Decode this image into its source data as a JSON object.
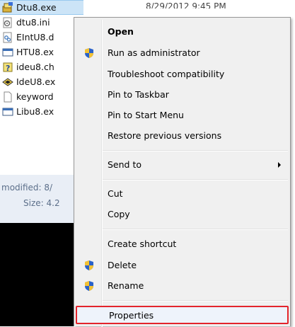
{
  "files": [
    {
      "name": "Dtu8.exe",
      "icon": "app-setup-icon",
      "selected": true
    },
    {
      "name": "dtu8.ini",
      "icon": "settings-file-icon"
    },
    {
      "name": "EIntU8.d",
      "icon": "dll-file-icon"
    },
    {
      "name": "HTU8.ex",
      "icon": "window-app-icon"
    },
    {
      "name": "ideu8.ch",
      "icon": "help-file-icon"
    },
    {
      "name": "IdeU8.ex",
      "icon": "ide-app-icon"
    },
    {
      "name": "keyword",
      "icon": "blank-file-icon"
    },
    {
      "name": "Libu8.ex",
      "icon": "window-app-icon"
    }
  ],
  "selected_date": "8/29/2012 9:45 PM",
  "details": {
    "modified": "modified: 8/",
    "size": "Size: 4.2"
  },
  "menu": {
    "items": [
      {
        "label": "Open",
        "bold": true
      },
      {
        "label": "Run as administrator",
        "icon": "uac-shield-icon"
      },
      {
        "label": "Troubleshoot compatibility"
      },
      {
        "label": "Pin to Taskbar"
      },
      {
        "label": "Pin to Start Menu"
      },
      {
        "label": "Restore previous versions"
      },
      {
        "label": "Send to",
        "submenu": true
      },
      {
        "label": "Cut"
      },
      {
        "label": "Copy"
      },
      {
        "label": "Create shortcut"
      },
      {
        "label": "Delete",
        "icon": "uac-shield-icon"
      },
      {
        "label": "Rename",
        "icon": "uac-shield-icon"
      },
      {
        "label": "Properties",
        "highlighted": true
      }
    ]
  },
  "colors": {
    "highlight_border": "#e3242b",
    "selection": "#cce4f7",
    "menu_bg": "#f0f0f0"
  }
}
